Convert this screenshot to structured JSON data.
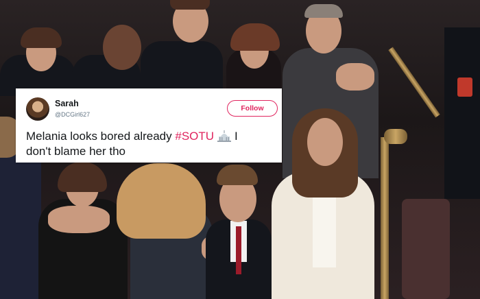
{
  "tweet": {
    "display_name": "Sarah",
    "handle": "@DCGirl627",
    "follow_label": "Follow",
    "text_before": "Melania looks bored already",
    "hashtag": "#SOTU",
    "emoji_icon": "capitol-building-icon",
    "text_after_line1": "I",
    "text_line2": "don't blame her tho"
  },
  "colors": {
    "accent": "#e0245e",
    "text": "#14171a",
    "muted": "#657786",
    "card_bg": "#ffffff"
  }
}
